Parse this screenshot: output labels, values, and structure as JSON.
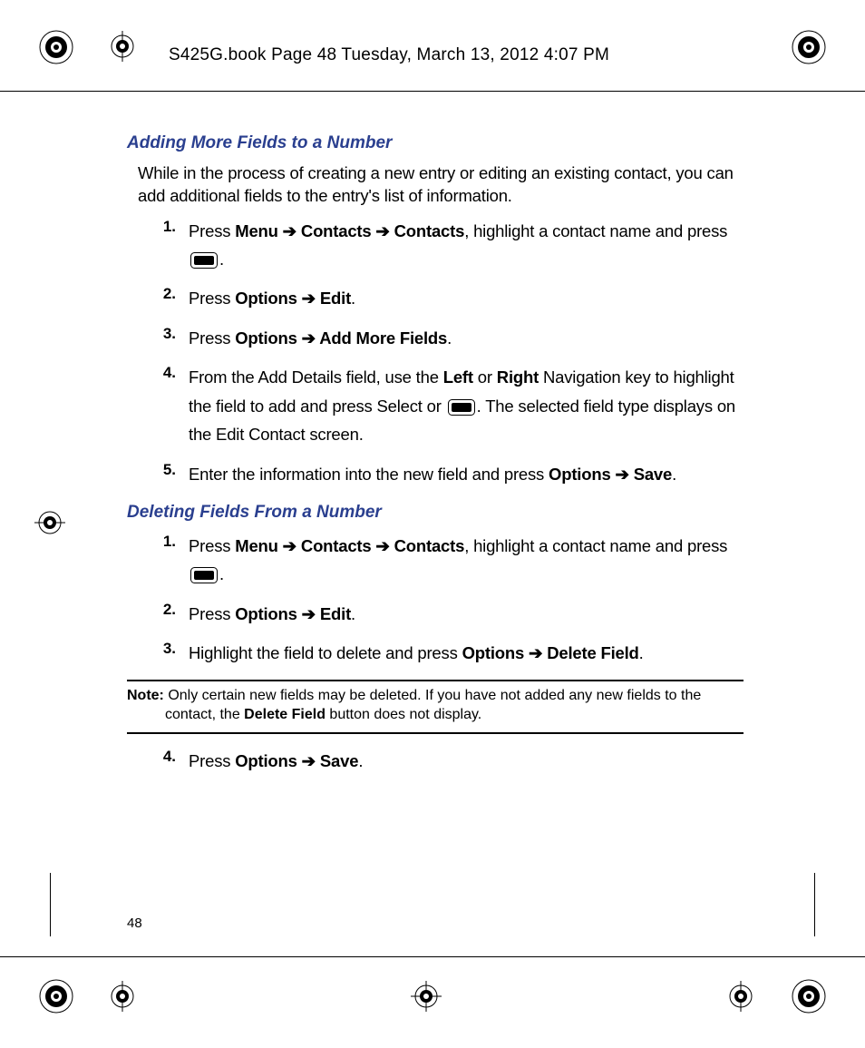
{
  "header": {
    "text": "S425G.book  Page 48  Tuesday, March 13, 2012  4:07 PM"
  },
  "page_number": "48",
  "sections": [
    {
      "heading": "Adding More Fields to a Number",
      "intro": "While in the process of creating a new entry or editing an existing contact, you can add additional fields to the entry's list of information.",
      "steps": [
        {
          "n": "1.",
          "pre": "Press ",
          "bold1": "Menu ➔ Contacts ➔ Contacts",
          "mid": ", highlight a contact name and press ",
          "icon": true,
          "post": "."
        },
        {
          "n": "2.",
          "pre": "Press ",
          "bold1": "Options ➔ Edit",
          "post": "."
        },
        {
          "n": "3.",
          "pre": "Press ",
          "bold1": "Options ➔ Add More Fields",
          "post": "."
        },
        {
          "n": "4.",
          "pre": "From the Add Details field, use the ",
          "bold1": "Left",
          "mid": " or ",
          "bold2": "Right",
          "mid2": " Navigation key to highlight the field to add and press Select or ",
          "icon": true,
          "post": ". The selected field type displays on the Edit Contact screen."
        },
        {
          "n": "5.",
          "pre": "Enter the information into the new field and press ",
          "bold1": "Options ➔ Save",
          "post": "."
        }
      ]
    },
    {
      "heading": "Deleting Fields From a Number",
      "steps": [
        {
          "n": "1.",
          "pre": "Press ",
          "bold1": "Menu ➔ Contacts ➔ Contacts",
          "mid": ", highlight a contact name and press ",
          "icon": true,
          "post": "."
        },
        {
          "n": "2.",
          "pre": "Press ",
          "bold1": "Options ➔ Edit",
          "post": "."
        },
        {
          "n": "3.",
          "pre": "Highlight the field to delete and press ",
          "bold1": "Options ➔ Delete Field",
          "post": "."
        }
      ],
      "note": {
        "label": "Note:",
        "text_pre": " Only certain new fields may be deleted. If you have not added any new fields to the contact, the ",
        "bold": "Delete Field",
        "text_post": " button does not display."
      },
      "steps_after": [
        {
          "n": "4.",
          "pre": "Press ",
          "bold1": "Options ➔ Save",
          "post": "."
        }
      ]
    }
  ]
}
